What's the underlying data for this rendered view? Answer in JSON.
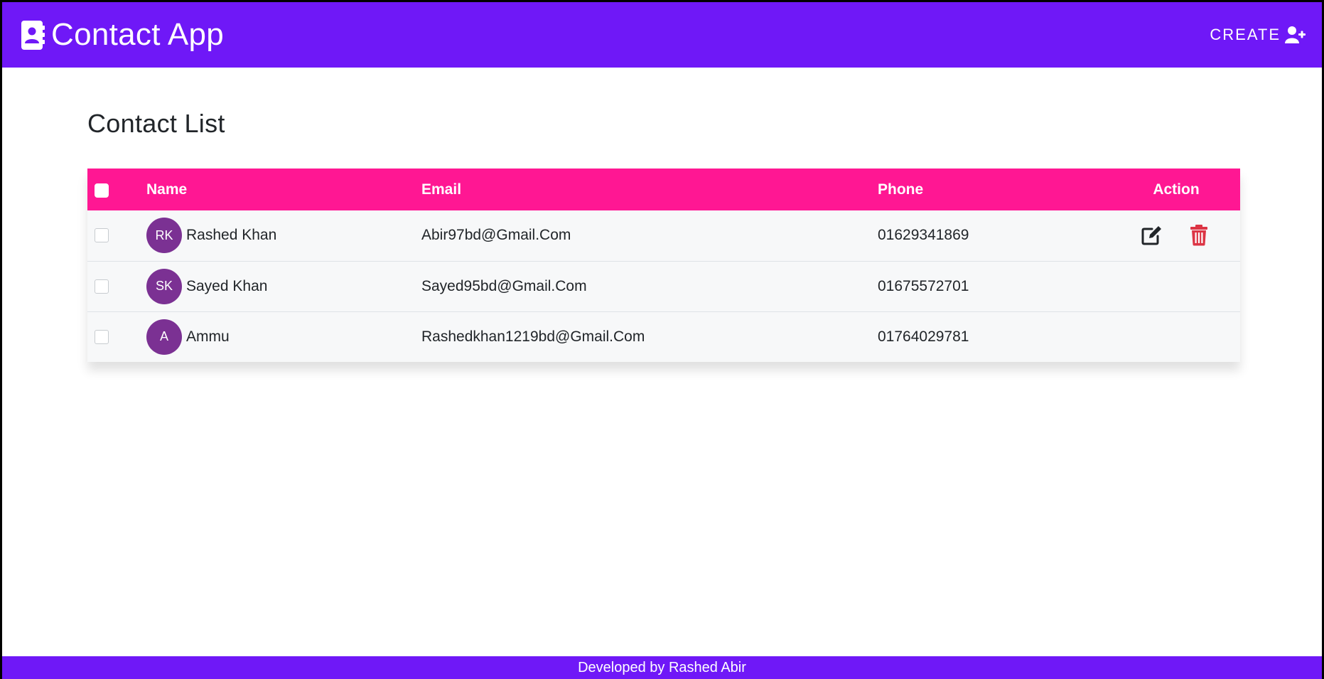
{
  "navbar": {
    "brand_text": "Contact App",
    "brand_icon": "address-book-icon",
    "create_label": "CREATE",
    "create_icon": "user-plus-icon"
  },
  "page": {
    "title": "Contact List"
  },
  "table": {
    "columns": [
      "Name",
      "Email",
      "Phone",
      "Action"
    ],
    "rows": [
      {
        "initials": "RK",
        "name": "Rashed Khan",
        "email": "Abir97bd@Gmail.Com",
        "phone": "01629341869",
        "has_actions": true
      },
      {
        "initials": "SK",
        "name": "Sayed Khan",
        "email": "Sayed95bd@Gmail.Com",
        "phone": "01675572701",
        "has_actions": false
      },
      {
        "initials": "A",
        "name": "Ammu",
        "email": "Rashedkhan1219bd@Gmail.Com",
        "phone": "01764029781",
        "has_actions": false
      }
    ],
    "action_icons": [
      "edit-icon",
      "trash-icon"
    ]
  },
  "footer": {
    "text": "Developed by Rashed Abir"
  },
  "colors": {
    "navbar": "#6f18f7",
    "table_header": "#ff1793",
    "avatar": "#7b3193",
    "delete": "#dc3545"
  }
}
